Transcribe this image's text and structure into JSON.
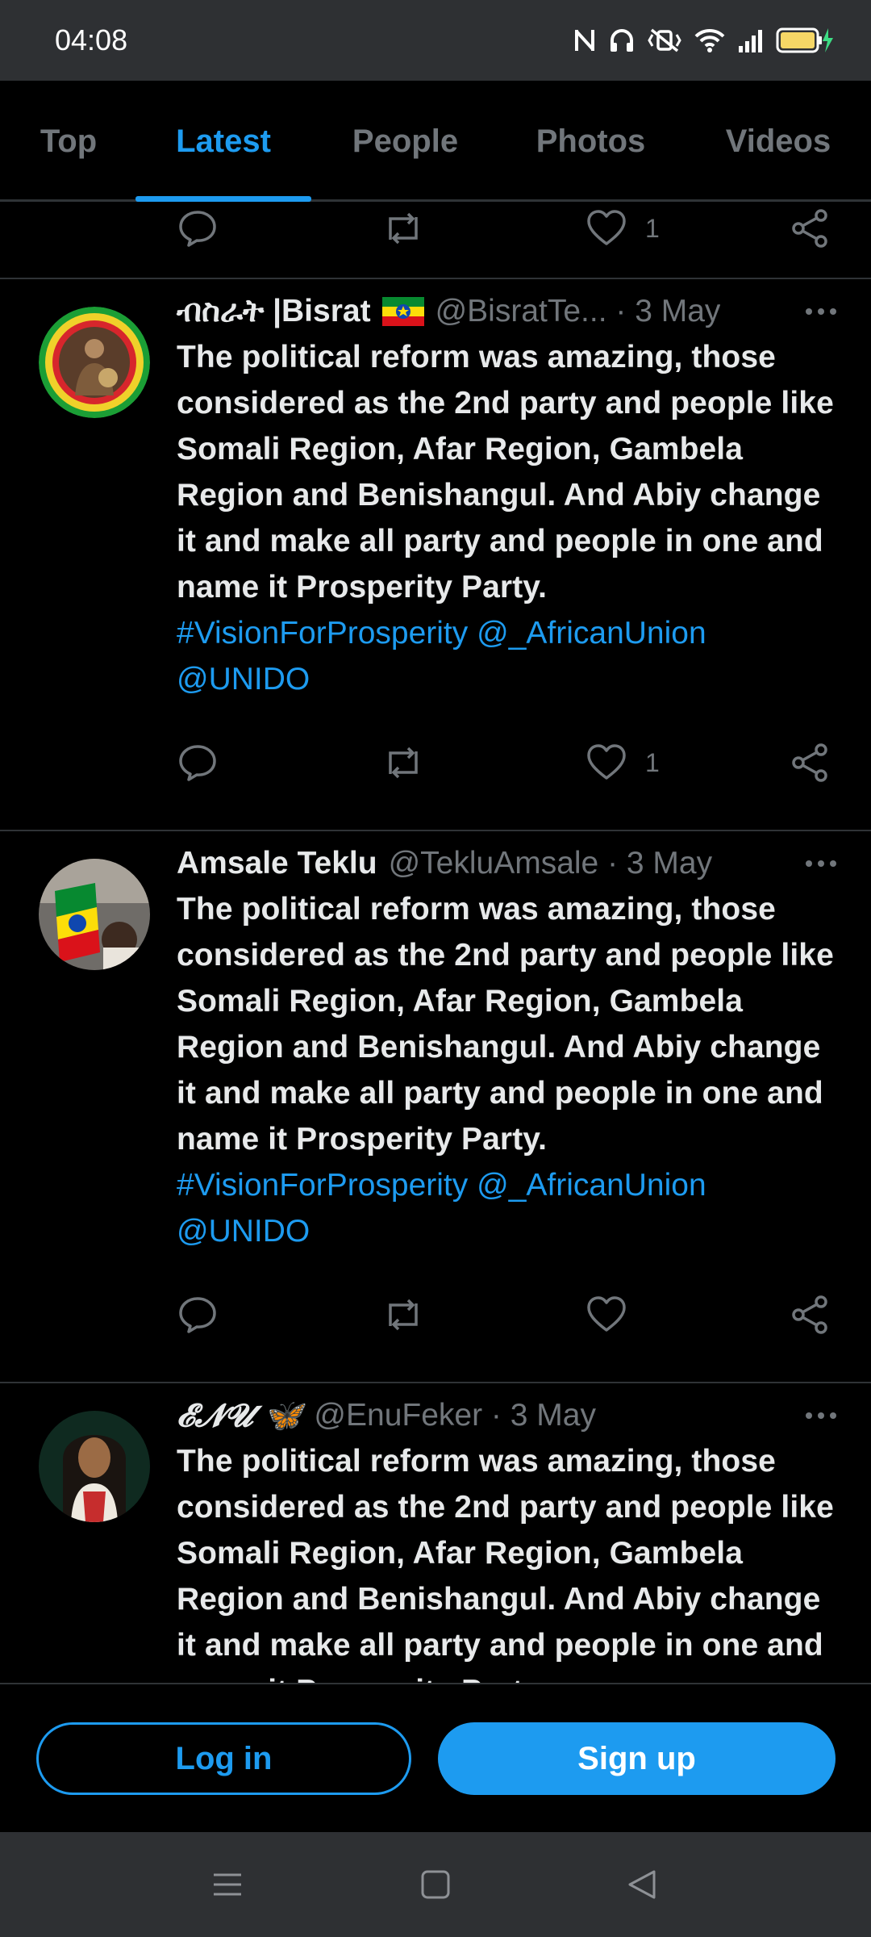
{
  "status_bar": {
    "time": "04:08"
  },
  "tabs": [
    {
      "label": "Top",
      "active": false
    },
    {
      "label": "Latest",
      "active": true
    },
    {
      "label": "People",
      "active": false
    },
    {
      "label": "Photos",
      "active": false
    },
    {
      "label": "Videos",
      "active": false
    }
  ],
  "previous_tweet_actions": {
    "like_count": "1"
  },
  "tweets": [
    {
      "display_name": "ብስራት |Bisrat",
      "handle_meta": "@BisratTe... · 3 May",
      "text": "The political reform was amazing, those considered as the 2nd party and people like Somali Region, Afar Region, Gambela Region and Benishangul. And Abiy change it and make all party and people in one and name it Prosperity Party.",
      "links_line1": "#VisionForProsperity @_AfricanUnion",
      "links_line2": "@UNIDO",
      "like_count": "1"
    },
    {
      "display_name": "Amsale Teklu",
      "handle_meta": "@TekluAmsale · 3 May",
      "text": "The political reform was amazing, those considered as the 2nd party and people like Somali Region, Afar Region, Gambela Region and Benishangul. And Abiy change it and make all party and people in one and name it Prosperity Party.",
      "links_line1": "#VisionForProsperity @_AfricanUnion",
      "links_line2": "@UNIDO",
      "like_count": ""
    },
    {
      "display_name": "𝓔𝓝𝓤 🦋",
      "handle_meta": "@EnuFeker · 3 May",
      "text": "The political reform was amazing, those considered as the 2nd party and people like Somali Region, Afar Region, Gambela Region and Benishangul. And Abiy change it and make all party and people in one and name it Prosperity Party.",
      "links_line1": "",
      "links_line2": "",
      "like_count": ""
    }
  ],
  "cta": {
    "login_label": "Log in",
    "signup_label": "Sign up"
  },
  "colors": {
    "accent": "#1d9bf0",
    "background": "#000000",
    "muted": "#71767b"
  }
}
